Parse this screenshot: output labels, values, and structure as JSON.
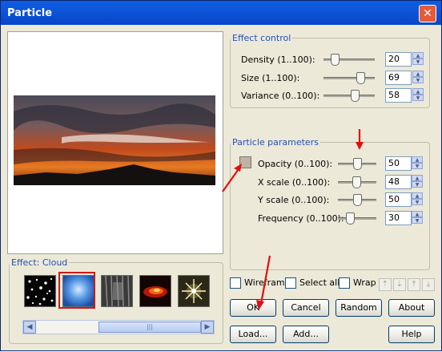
{
  "window": {
    "title": "Particle",
    "close_glyph": "✕"
  },
  "effect_control": {
    "legend": "Effect control",
    "rows": [
      {
        "label": "Density (1..100):",
        "value": "20"
      },
      {
        "label": "Size (1..100):",
        "value": "69"
      },
      {
        "label": "Variance (0..100):",
        "value": "58"
      }
    ]
  },
  "particle_parameters": {
    "legend": "Particle parameters",
    "swatch_color": "#bfb3a6",
    "rows": [
      {
        "label": "Opacity (0..100):",
        "value": "50"
      },
      {
        "label": "X scale (0..100):",
        "value": "48"
      },
      {
        "label": "Y scale (0..100):",
        "value": "50"
      },
      {
        "label": "Frequency (0..100):",
        "value": "30"
      }
    ]
  },
  "effect_panel": {
    "legend": "Effect: Cloud",
    "thumbnails": [
      "starfield",
      "cloud",
      "rain",
      "fire",
      "sparkle"
    ],
    "selected": "cloud",
    "scroll_glyph": "|||"
  },
  "options": {
    "wireframe": "Wireframe",
    "select_all": "Select all",
    "wrap": "Wrap"
  },
  "buttons": {
    "ok": "OK",
    "cancel": "Cancel",
    "random": "Random",
    "about": "About",
    "load": "Load...",
    "add": "Add...",
    "help": "Help"
  },
  "arrow_buttons": [
    "arrow-up-icon",
    "arrow-down-icon",
    "arrow-top-icon",
    "arrow-bottom-icon"
  ],
  "annotations": {
    "arrow_color": "#e01010"
  }
}
